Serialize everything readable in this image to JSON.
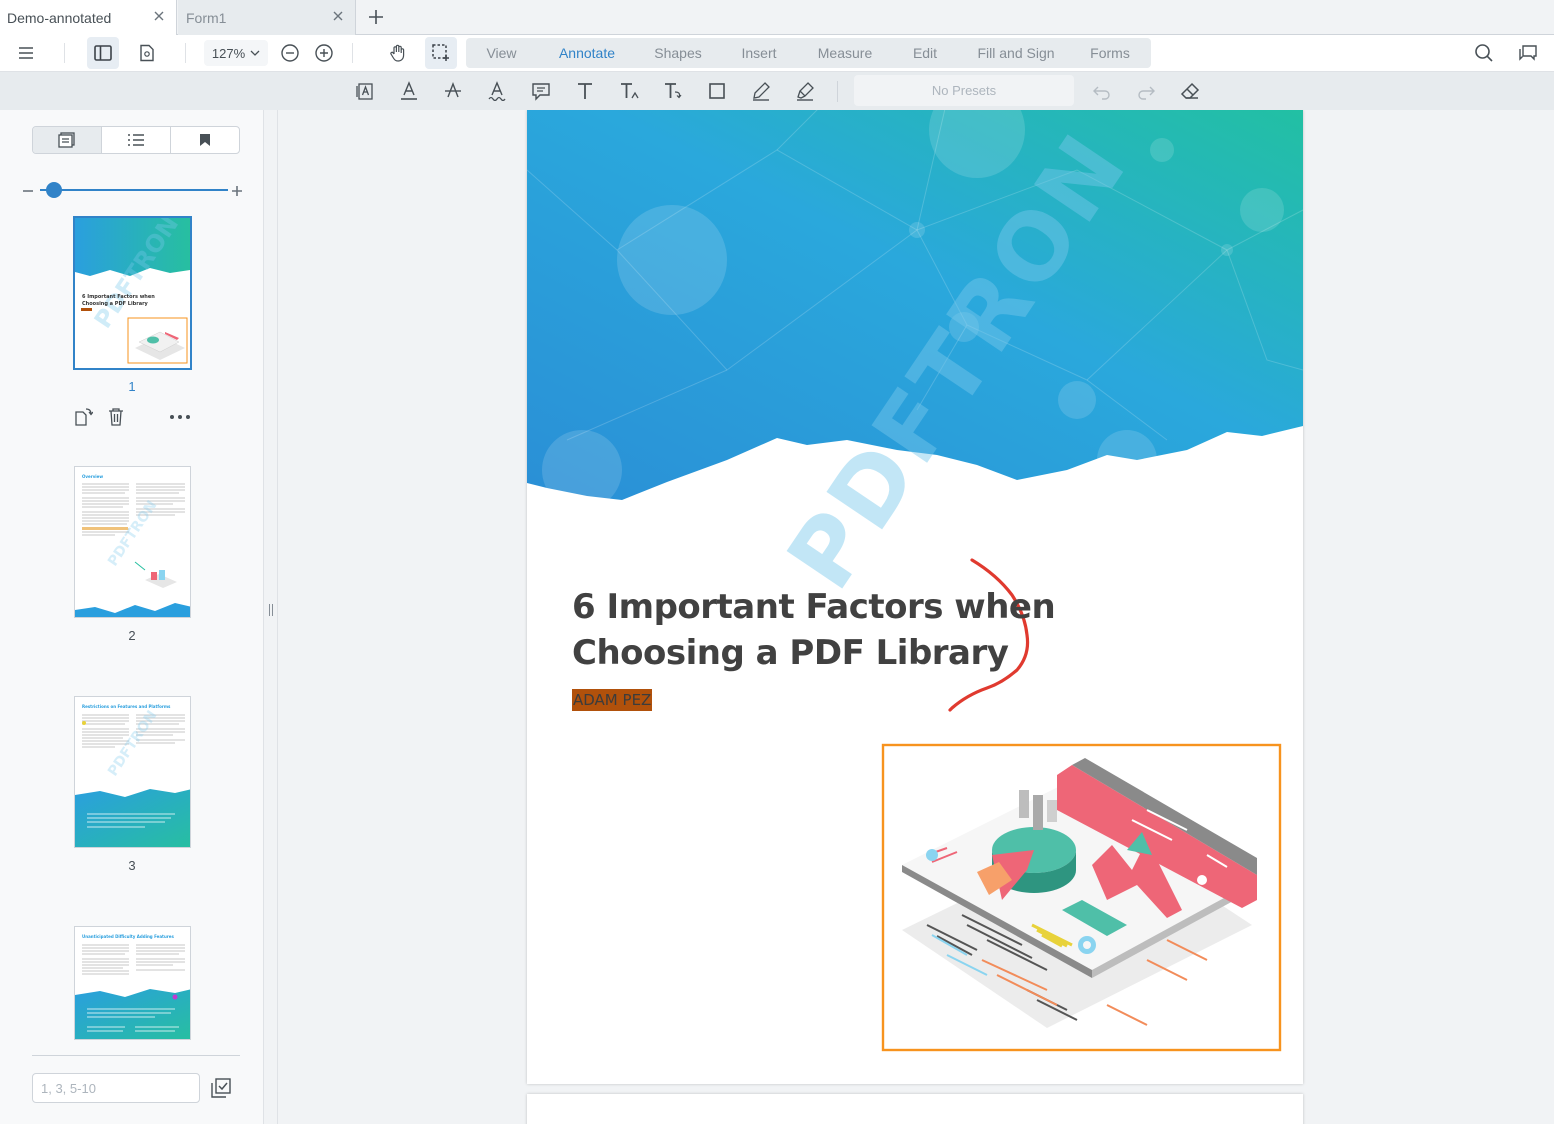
{
  "tabs": [
    {
      "label": "Demo-annotated",
      "active": true
    },
    {
      "label": "Form1",
      "active": false
    }
  ],
  "header": {
    "zoom_label": "127",
    "zoom_unit": "%",
    "ribbons": [
      {
        "label": "View",
        "active": false
      },
      {
        "label": "Annotate",
        "active": true
      },
      {
        "label": "Shapes",
        "active": false
      },
      {
        "label": "Insert",
        "active": false
      },
      {
        "label": "Measure",
        "active": false
      },
      {
        "label": "Edit",
        "active": false
      },
      {
        "label": "Fill and Sign",
        "active": false
      },
      {
        "label": "Forms",
        "active": false
      }
    ],
    "icons": [
      "menu-icon",
      "sidebar-toggle-icon",
      "document-icon",
      "zoom-out-icon",
      "zoom-in-icon",
      "pan-icon",
      "marquee-select-icon",
      "search-icon",
      "comments-icon"
    ]
  },
  "tools": {
    "presets_label": "No Presets",
    "icons": [
      "free-text-icon",
      "underline-icon",
      "strikeout-icon",
      "squiggly-icon",
      "sticky-note-icon",
      "text-icon",
      "text-insert-icon",
      "text-replace-icon",
      "rectangle-icon",
      "freehand-icon",
      "highlight-icon",
      "undo-icon",
      "redo-icon",
      "eraser-icon"
    ]
  },
  "left_panel": {
    "tab_icons": [
      "thumbnails-icon",
      "outline-icon",
      "bookmark-icon"
    ],
    "active_tab": 0,
    "thumbnails": [
      {
        "page": "1",
        "selected": true
      },
      {
        "page": "2",
        "selected": false
      },
      {
        "page": "3",
        "selected": false
      },
      {
        "page": "4",
        "selected": false
      }
    ],
    "page_range_placeholder": "1, 3, 5-10",
    "thumbnail_title": "6 Important Factors when Choosing a PDF Library"
  },
  "document": {
    "title_line1": "6 Important Factors when",
    "title_line2": "Choosing a PDF Library",
    "author": "ADAM PEZ",
    "watermark": "PDFTRON",
    "colors": {
      "highlight": "#b1510b",
      "ink": "#e03a2f",
      "rectangle_outline": "#f7931e",
      "accent": "#3183c8"
    }
  }
}
